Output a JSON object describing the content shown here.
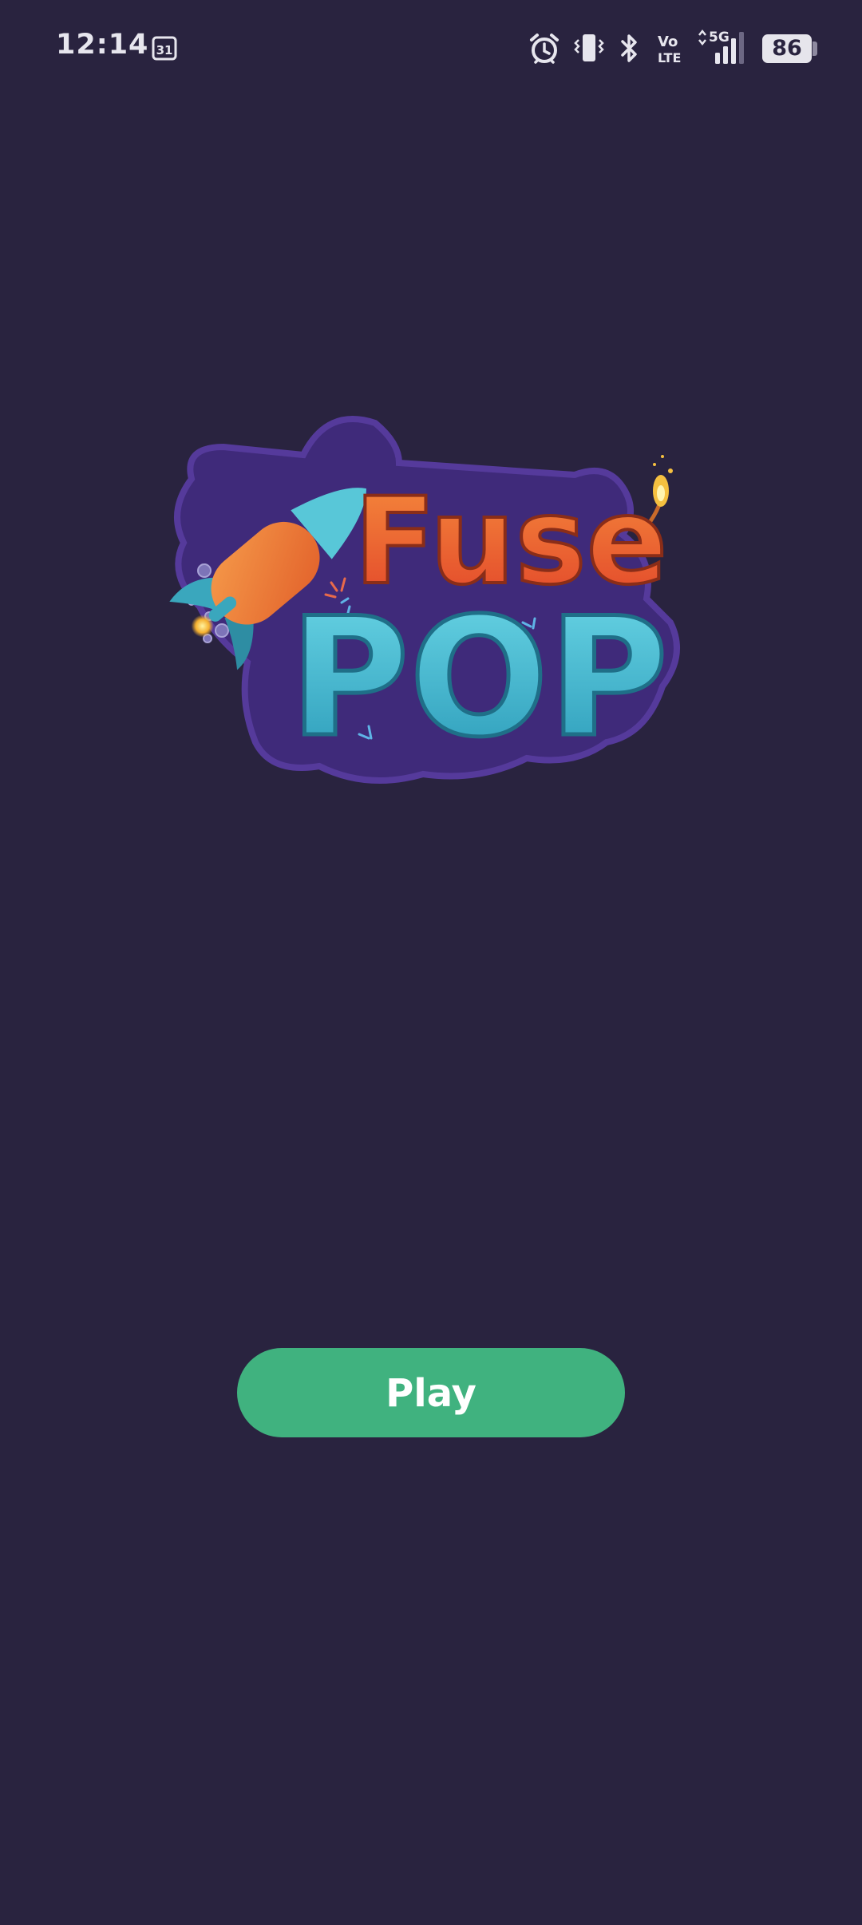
{
  "status_bar": {
    "time": "12:14",
    "calendar_day": "31",
    "volte_top": "Vo",
    "volte_bottom": "LTE",
    "network": "5G",
    "battery": "86",
    "icons": [
      "calendar-icon",
      "alarm-icon",
      "vibrate-icon",
      "bluetooth-icon",
      "volte-icon",
      "signal-icon",
      "battery-icon"
    ]
  },
  "logo": {
    "line1": "Fuse",
    "line2": "POP",
    "colors": {
      "badge": "#4a2f8c",
      "fuse": "#f06a2c",
      "pop": "#3fb6cf",
      "rocket_body": "#f07a32",
      "rocket_fin": "#3aa7bd"
    }
  },
  "play_button": {
    "label": "Play",
    "color": "#40b27f"
  },
  "theme": {
    "background": "#29233f"
  }
}
